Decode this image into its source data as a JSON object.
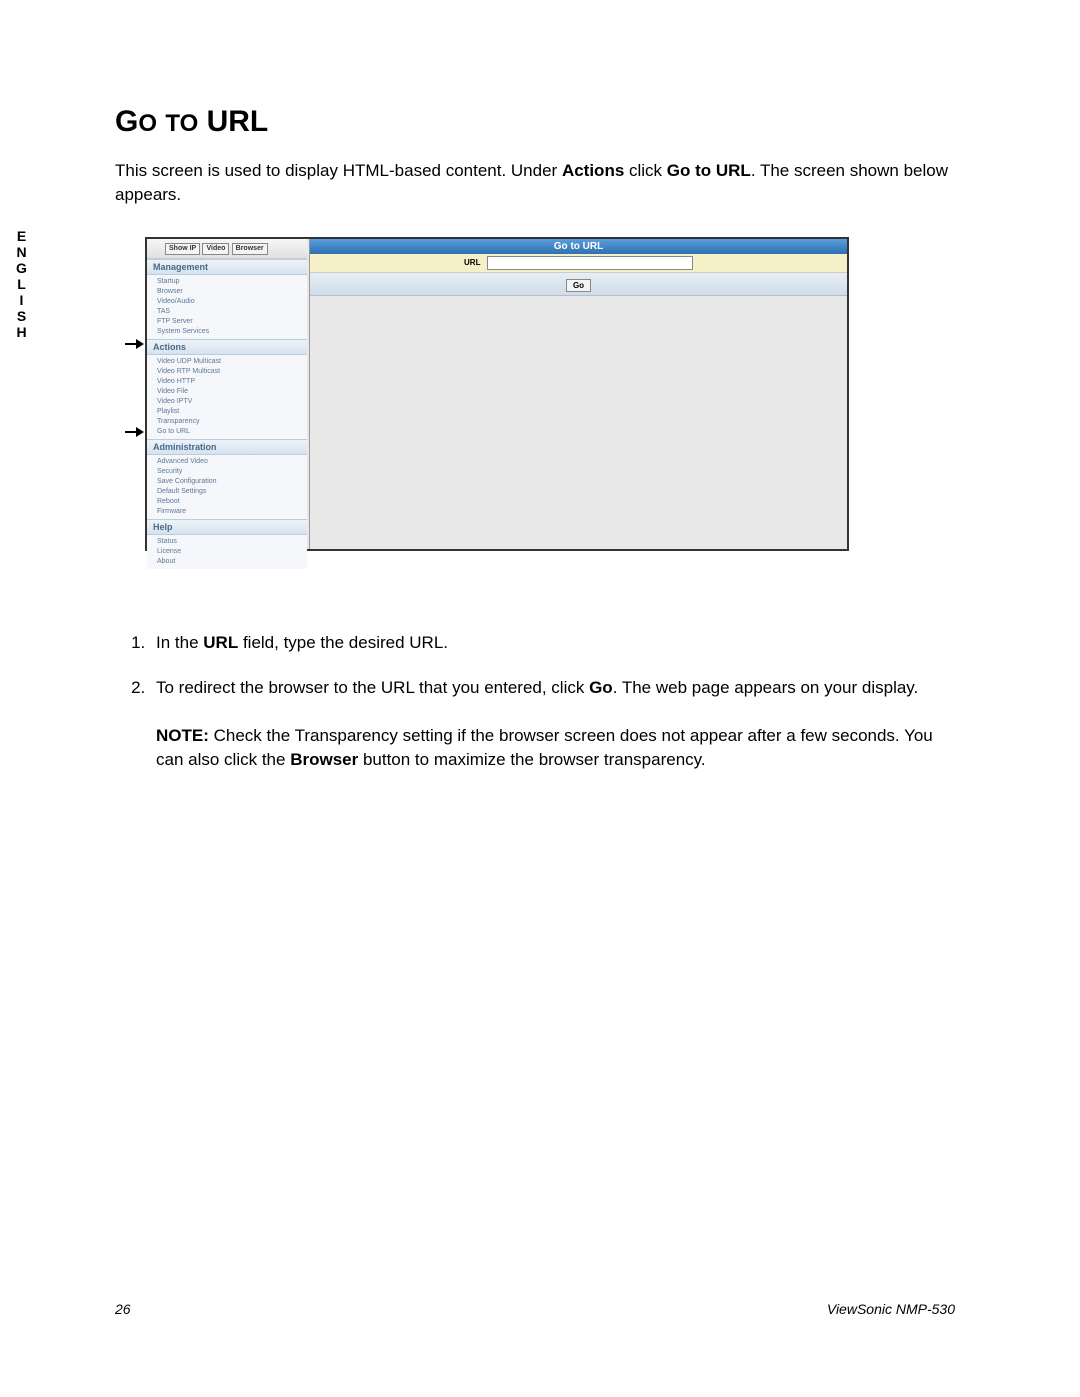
{
  "side_tab": [
    "E",
    "N",
    "G",
    "L",
    "I",
    "S",
    "H"
  ],
  "heading": "Go to URL",
  "intro_pre": "This screen is used to display HTML-based content. Under ",
  "intro_b1": "Actions",
  "intro_mid": " click ",
  "intro_b2": "Go to URL",
  "intro_post": ". The screen shown below appears.",
  "screenshot": {
    "top_buttons": [
      "Show IP",
      "Video",
      "Browser"
    ],
    "sections": [
      {
        "header": "Management",
        "items": [
          "Startup",
          "Browser",
          "Video/Audio",
          "TAS",
          "FTP Server",
          "System Services"
        ]
      },
      {
        "header": "Actions",
        "arrow": true,
        "items": [
          "Video UDP Multicast",
          "Video RTP Multicast",
          "Video HTTP",
          "Video File",
          "Video IPTV",
          "Playlist",
          "Transparency",
          "Go to URL"
        ]
      },
      {
        "header": "Administration",
        "items": [
          "Advanced Video",
          "Security",
          "Save Configuration",
          "Default Settings",
          "Reboot",
          "Firmware"
        ]
      },
      {
        "header": "Help",
        "items": [
          "Status",
          "License",
          "About"
        ]
      }
    ],
    "main_title": "Go to URL",
    "url_label": "URL",
    "go_label": "Go"
  },
  "step1_pre": "In the ",
  "step1_b": "URL",
  "step1_post": " field, type the desired URL.",
  "step2_pre": "To redirect the browser to the URL that you entered, click ",
  "step2_b": "Go",
  "step2_post": ". The web page appears on your display.",
  "note_label": "NOTE:",
  "note_pre": " Check the Transparency setting if the browser screen does not appear after a few seconds. You can also click the ",
  "note_b": "Browser",
  "note_post": " button to maximize the browser transparency.",
  "footer_page": "26",
  "footer_doc": "ViewSonic NMP-530"
}
